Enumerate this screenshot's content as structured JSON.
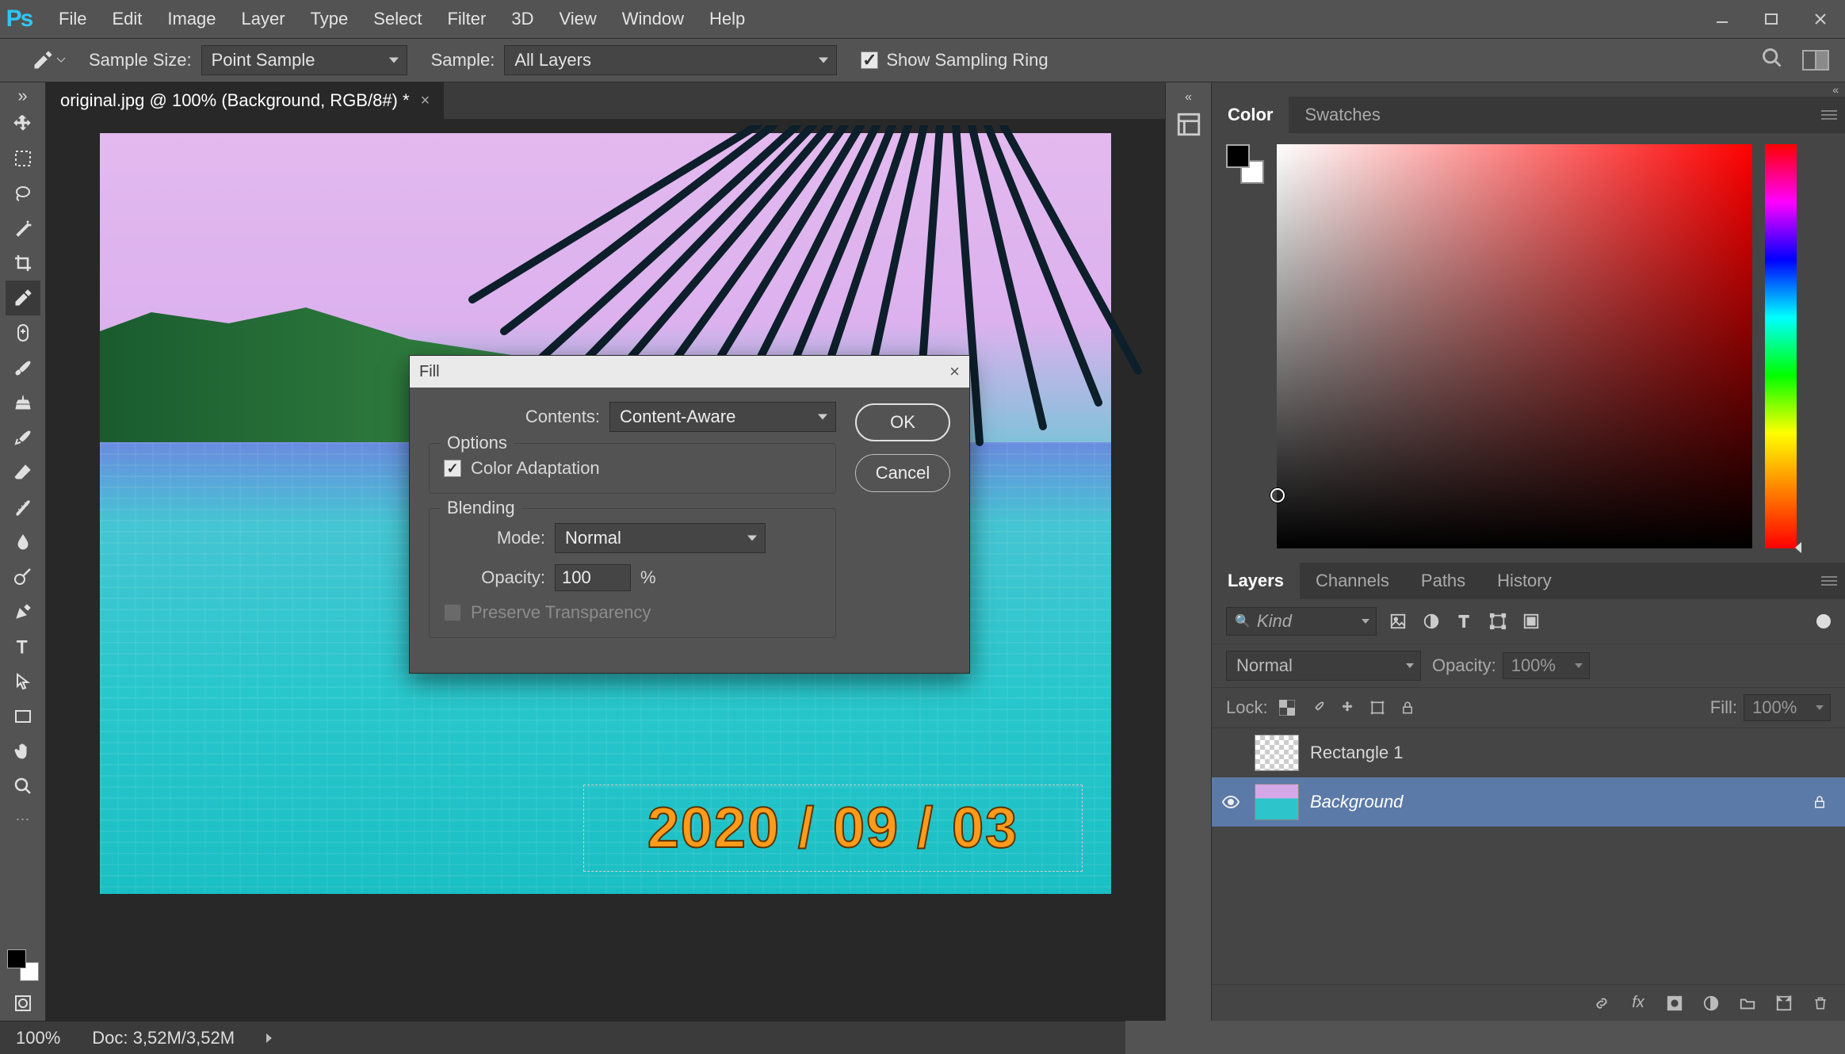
{
  "menu": [
    "File",
    "Edit",
    "Image",
    "Layer",
    "Type",
    "Select",
    "Filter",
    "3D",
    "View",
    "Window",
    "Help"
  ],
  "options_bar": {
    "sample_size_label": "Sample Size:",
    "sample_size_value": "Point Sample",
    "sample_label": "Sample:",
    "sample_value": "All Layers",
    "show_ring_label": "Show Sampling Ring",
    "show_ring_checked": true
  },
  "document": {
    "tab_title": "original.jpg @ 100% (Background, RGB/8#) *",
    "date_stamp": "2020 / 09 / 03"
  },
  "fill_dialog": {
    "title": "Fill",
    "contents_label": "Contents:",
    "contents_value": "Content-Aware",
    "options_legend": "Options",
    "color_adaptation_label": "Color Adaptation",
    "color_adaptation_checked": true,
    "blending_legend": "Blending",
    "mode_label": "Mode:",
    "mode_value": "Normal",
    "opacity_label": "Opacity:",
    "opacity_value": "100",
    "opacity_unit": "%",
    "preserve_transparency_label": "Preserve Transparency",
    "ok_label": "OK",
    "cancel_label": "Cancel"
  },
  "panels": {
    "color_tabs": [
      "Color",
      "Swatches"
    ],
    "layer_tabs": [
      "Layers",
      "Channels",
      "Paths",
      "History"
    ],
    "kind_label": "Kind",
    "blend_mode": "Normal",
    "opacity_label": "Opacity:",
    "opacity_value": "100%",
    "lock_label": "Lock:",
    "fill_label": "Fill:",
    "fill_value": "100%",
    "layers": [
      {
        "name": "Rectangle 1",
        "visible": false,
        "locked": false,
        "italic": false,
        "selected": false,
        "thumb": "shape"
      },
      {
        "name": "Background",
        "visible": true,
        "locked": true,
        "italic": true,
        "selected": true,
        "thumb": "bg"
      }
    ]
  },
  "status": {
    "zoom": "100%",
    "doc_size": "Doc: 3,52M/3,52M"
  }
}
